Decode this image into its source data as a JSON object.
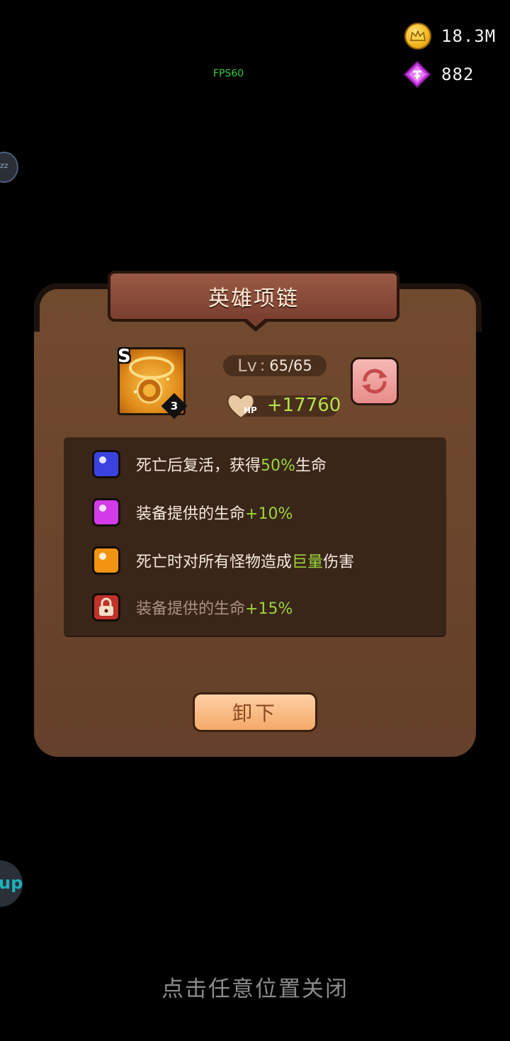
{
  "currencies": {
    "gold": {
      "icon": "crown-coin-icon",
      "value": "18.3M"
    },
    "gems": {
      "icon": "purple-gem-icon",
      "value": "882"
    }
  },
  "debug": {
    "fps": "FPS60"
  },
  "side_buttons": {
    "top_label": "zz",
    "bottom_label": "up"
  },
  "dialog": {
    "title": "英雄项链",
    "item": {
      "grade": "S",
      "count": "3",
      "icon": "lion-necklace-icon"
    },
    "level": {
      "label": "Lv",
      "value": "65/65"
    },
    "stat": {
      "icon": "heart-hp-icon",
      "label": "HP",
      "value": "+17760"
    },
    "refresh_icon": "refresh-icon",
    "skills": [
      {
        "color": "blue",
        "parts": [
          "死亡后复活，获得",
          "50%",
          "生命"
        ],
        "locked": false
      },
      {
        "color": "purple",
        "parts": [
          "装备提供的生命",
          "+10%",
          ""
        ],
        "locked": false
      },
      {
        "color": "orange",
        "parts": [
          "死亡时对所有怪物造成",
          "巨量",
          "伤害"
        ],
        "locked": false
      },
      {
        "color": "red",
        "parts": [
          "装备提供的生命",
          "+15%",
          ""
        ],
        "locked": true
      }
    ],
    "unequip_label": "卸下"
  },
  "close_hint": "点击任意位置关闭",
  "colors": {
    "blue_gem": "#3a43e0",
    "purple_gem": "#d33ae8",
    "orange_gem": "#f29412",
    "red_lock": "#c0322a",
    "highlight": "#9bd63b"
  }
}
